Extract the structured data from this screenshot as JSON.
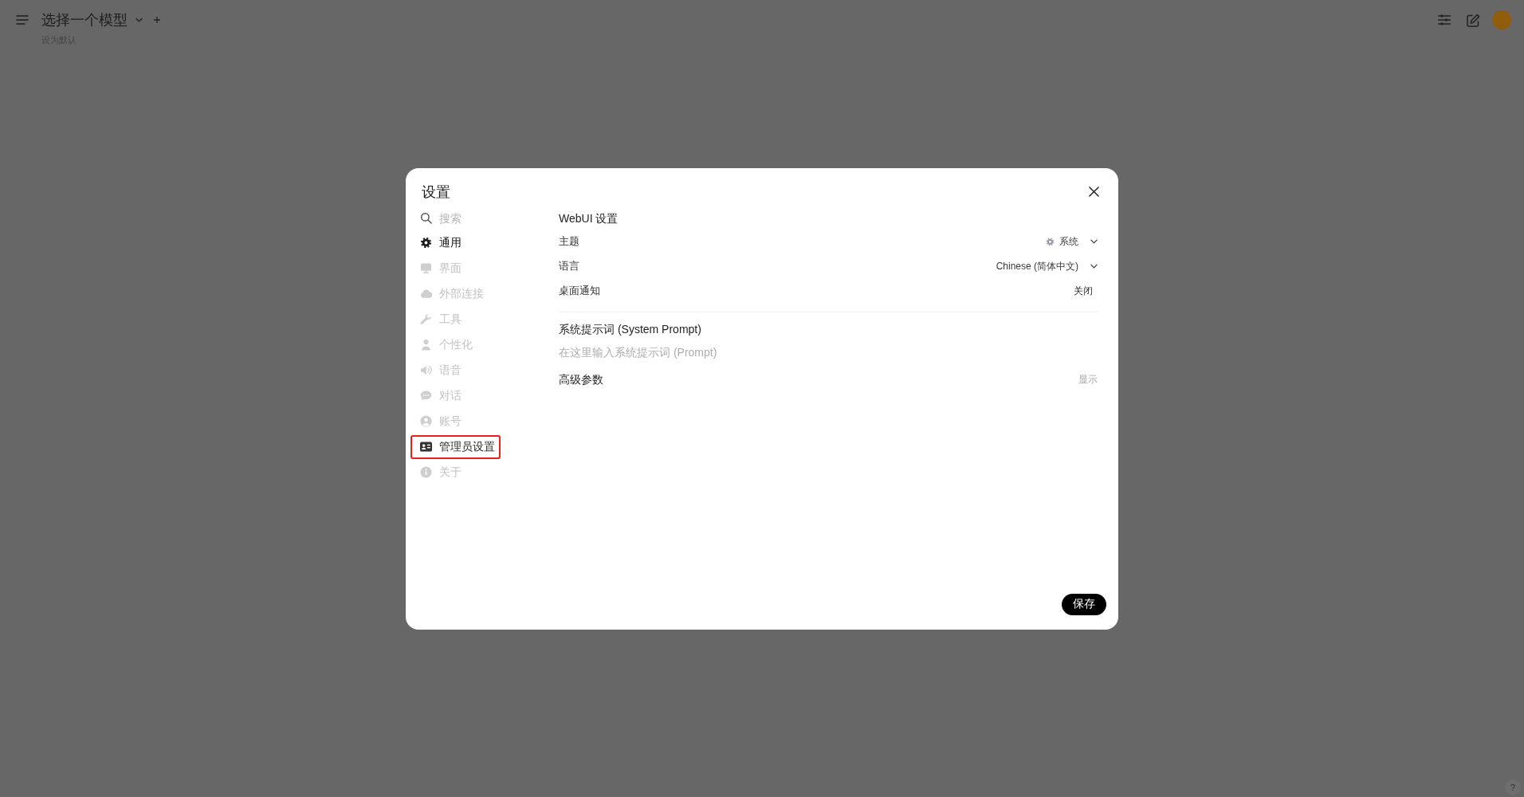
{
  "header": {
    "model_title": "选择一个模型",
    "set_default": "设为默认"
  },
  "settings_dialog": {
    "title": "设置",
    "search": {
      "placeholder": "搜索"
    },
    "nav": [
      {
        "kind": "tab",
        "label": "通用",
        "selected": true,
        "highlighted": false
      },
      {
        "kind": "tab",
        "label": "界面",
        "selected": false,
        "highlighted": false
      },
      {
        "kind": "tab",
        "label": "外部连接",
        "selected": false,
        "highlighted": false
      },
      {
        "kind": "tab",
        "label": "工具",
        "selected": false,
        "highlighted": false
      },
      {
        "kind": "tab",
        "label": "个性化",
        "selected": false,
        "highlighted": false
      },
      {
        "kind": "tab",
        "label": "语音",
        "selected": false,
        "highlighted": false
      },
      {
        "kind": "tab",
        "label": "对话",
        "selected": false,
        "highlighted": false
      },
      {
        "kind": "tab",
        "label": "账号",
        "selected": false,
        "highlighted": false
      },
      {
        "kind": "link",
        "label": "管理员设置",
        "selected": false,
        "highlighted": true
      },
      {
        "kind": "tab",
        "label": "关于",
        "selected": false,
        "highlighted": false
      }
    ],
    "section_title": "WebUI 设置",
    "settings": [
      {
        "kind": "select-icon",
        "label": "主题",
        "value": "系统"
      },
      {
        "kind": "select",
        "label": "语言",
        "value": "Chinese (简体中文)"
      },
      {
        "kind": "button",
        "label": "桌面通知",
        "value": "关闭"
      }
    ],
    "system_prompt": {
      "title": "系统提示词 (System Prompt)",
      "placeholder": "在这里输入系统提示词 (Prompt)"
    },
    "advanced": {
      "label": "高级参数",
      "action": "显示"
    },
    "save_button": "保存"
  },
  "help_button": "?"
}
